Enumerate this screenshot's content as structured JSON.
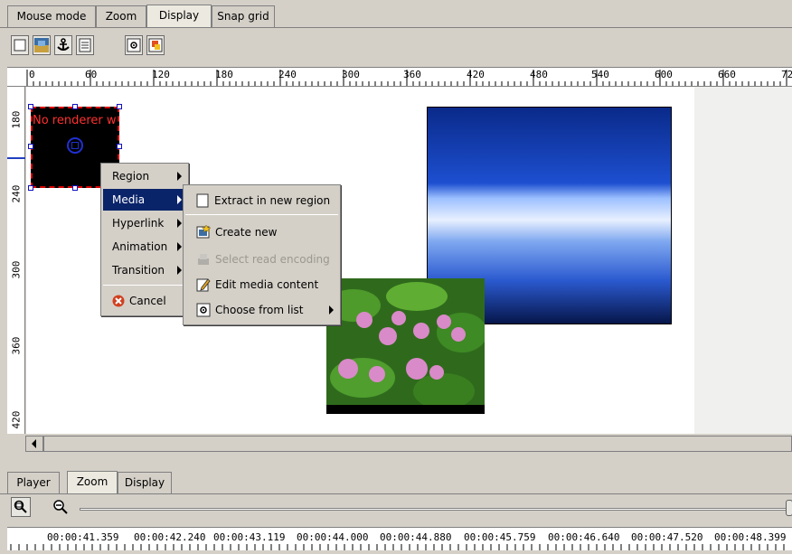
{
  "top_tabs": [
    "Mouse mode",
    "Zoom",
    "Display",
    "Snap grid"
  ],
  "top_ruler": [
    "0",
    "60",
    "120",
    "180",
    "240",
    "300",
    "360",
    "420",
    "480",
    "540",
    "600",
    "660",
    "72"
  ],
  "left_ruler": [
    "180",
    "240",
    "300",
    "360",
    "420"
  ],
  "region": {
    "text": "No renderer w"
  },
  "menu": {
    "items": [
      "Region",
      "Media",
      "Hyperlink",
      "Animation",
      "Transition"
    ],
    "cancel": "Cancel"
  },
  "submenu": {
    "extract": "Extract in new region",
    "create": "Create new",
    "select_read": "Select read encoding",
    "edit": "Edit media content",
    "choose": "Choose from list"
  },
  "bottom_tabs": [
    "Player",
    "Zoom",
    "Display"
  ],
  "timeline": [
    "00:00:41.359",
    "00:00:42.240",
    "00:00:43.119",
    "00:00:44.000",
    "00:00:44.880",
    "00:00:45.759",
    "00:00:46.640",
    "00:00:47.520",
    "00:00:48.399"
  ],
  "colors": {
    "selection": "#0a246a",
    "region_border": "#d00000",
    "region_text": "#ff3030"
  }
}
